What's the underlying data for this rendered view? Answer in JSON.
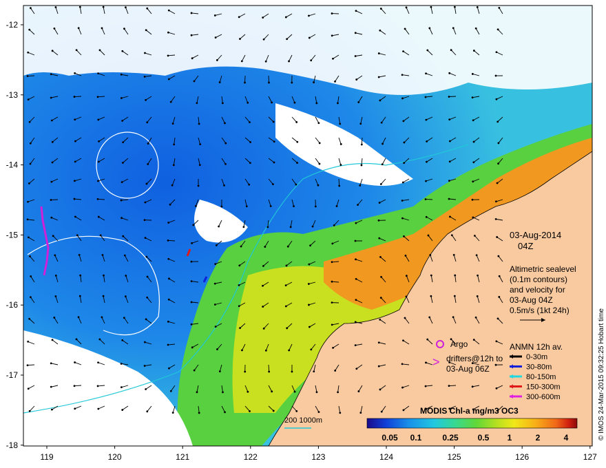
{
  "map": {
    "date_title": "03-Aug-2014",
    "time_title": "04Z",
    "description_lines": [
      "Altimetric sealevel",
      "(0.1m contours)",
      "and velocity for",
      "03-Aug 04Z",
      "0.5m/s (1kt 24h)"
    ],
    "argo_label": "Argo",
    "drifters_lines": [
      "drifters@12h to",
      "03-Aug 06Z"
    ],
    "anmn_title": "ANMN 12h av.",
    "anmn_depths": [
      {
        "label": "0-30m",
        "color": "#000000"
      },
      {
        "label": "30-80m",
        "color": "#1020d8"
      },
      {
        "label": "80-150m",
        "color": "#20d8e0"
      },
      {
        "label": "150-300m",
        "color": "#e01818"
      },
      {
        "label": "300-600m",
        "color": "#e020e0"
      }
    ],
    "colorbar_title": "MODIS Chl-a mg/m3 OC3",
    "colorbar_ticks": [
      "0.05",
      "0.1",
      "0.25",
      "0.5",
      "1",
      "2",
      "4"
    ],
    "isobath_label": "200  1000m",
    "credit": "© IMOS 24-Mar-2015 09:32:25 Hobart time",
    "lon_ticks": [
      "119",
      "120",
      "121",
      "122",
      "123",
      "124",
      "125",
      "126",
      "127"
    ],
    "lat_ticks": [
      "-12",
      "-13",
      "-14",
      "-15",
      "-16",
      "-17",
      "-18"
    ]
  },
  "colors": {
    "land": "#f9c9a0",
    "ocean_low": "#1878e8",
    "ocean_mid": "#30b8e8",
    "cloud": "#ffffff",
    "isobath": "#20c8d8",
    "sealevel_contour": "#ffffff",
    "argo": "#d020d8",
    "colorbar": [
      "#1a0a8a",
      "#1040d8",
      "#1890e8",
      "#20c8e0",
      "#38d890",
      "#60d838",
      "#b8e020",
      "#f0e818",
      "#f8b018",
      "#f06818",
      "#d02010",
      "#8a0a0a"
    ]
  }
}
